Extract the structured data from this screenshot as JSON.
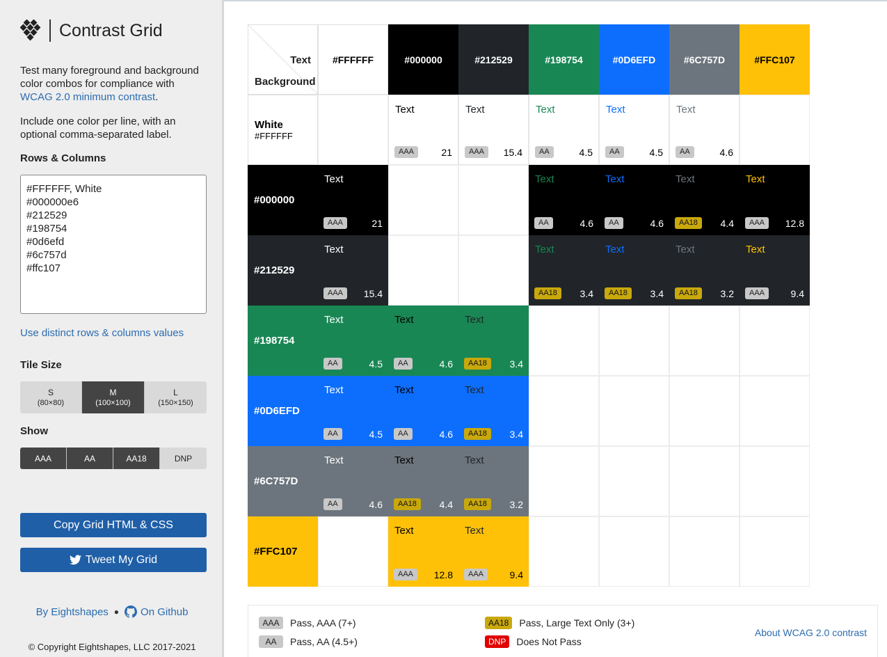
{
  "sidebar": {
    "title": "Contrast Grid",
    "intro_text": "Test many foreground and background color combos for compliance with",
    "intro_link": "WCAG 2.0 minimum contrast",
    "intro_end": ".",
    "intro2": "Include one color per line, with an optional comma-separated label.",
    "rows_label": "Rows & Columns",
    "rows_value": "#FFFFFF, White\n#000000e6\n#212529\n#198754\n#0d6efd\n#6c757d\n#ffc107",
    "distinct_link": "Use distinct rows & columns values",
    "tile_size_label": "Tile Size",
    "tile_sizes": [
      {
        "label": "S",
        "sub": "(80×80)",
        "selected": false
      },
      {
        "label": "M",
        "sub": "(100×100)",
        "selected": true
      },
      {
        "label": "L",
        "sub": "(150×150)",
        "selected": false
      }
    ],
    "show_label": "Show",
    "show_options": [
      {
        "label": "AAA",
        "selected": true
      },
      {
        "label": "AA",
        "selected": true
      },
      {
        "label": "AA18",
        "selected": true
      },
      {
        "label": "DNP",
        "selected": false
      }
    ],
    "copy_button": "Copy Grid HTML & CSS",
    "tweet_button": "Tweet My Grid",
    "by_link": "By Eightshapes",
    "github_link": "On Github",
    "copyright": "© Copyright Eightshapes, LLC 2017-2021"
  },
  "grid": {
    "corner_text": "Text",
    "corner_bg": "Background",
    "tile_word": "Text",
    "columns": [
      {
        "label": "#FFFFFF",
        "color": "#FFFFFF",
        "text": "#000000"
      },
      {
        "label": "#000000",
        "color": "#000000",
        "text": "#FFFFFF"
      },
      {
        "label": "#212529",
        "color": "#212529",
        "text": "#FFFFFF"
      },
      {
        "label": "#198754",
        "color": "#198754",
        "text": "#FFFFFF"
      },
      {
        "label": "#0D6EFD",
        "color": "#0D6EFD",
        "text": "#FFFFFF"
      },
      {
        "label": "#6C757D",
        "color": "#6C757D",
        "text": "#FFFFFF"
      },
      {
        "label": "#FFC107",
        "color": "#FFC107",
        "text": "#000000"
      }
    ],
    "rows": [
      {
        "label": "White",
        "sub": "#FFFFFF",
        "color": "#FFFFFF",
        "text": "#000000",
        "cells": [
          null,
          {
            "badge": "AAA",
            "ratio": "21"
          },
          {
            "badge": "AAA",
            "ratio": "15.4"
          },
          {
            "badge": "AA",
            "ratio": "4.5"
          },
          {
            "badge": "AA",
            "ratio": "4.5"
          },
          {
            "badge": "AA",
            "ratio": "4.6"
          },
          null
        ]
      },
      {
        "label": "#000000",
        "sub": "",
        "color": "#000000",
        "text": "#FFFFFF",
        "cells": [
          {
            "badge": "AAA",
            "ratio": "21"
          },
          null,
          null,
          {
            "badge": "AA",
            "ratio": "4.6"
          },
          {
            "badge": "AA",
            "ratio": "4.6"
          },
          {
            "badge": "AA18",
            "ratio": "4.4"
          },
          {
            "badge": "AAA",
            "ratio": "12.8"
          }
        ]
      },
      {
        "label": "#212529",
        "sub": "",
        "color": "#212529",
        "text": "#FFFFFF",
        "cells": [
          {
            "badge": "AAA",
            "ratio": "15.4"
          },
          null,
          null,
          {
            "badge": "AA18",
            "ratio": "3.4"
          },
          {
            "badge": "AA18",
            "ratio": "3.4"
          },
          {
            "badge": "AA18",
            "ratio": "3.2"
          },
          {
            "badge": "AAA",
            "ratio": "9.4"
          }
        ]
      },
      {
        "label": "#198754",
        "sub": "",
        "color": "#198754",
        "text": "#FFFFFF",
        "cells": [
          {
            "badge": "AA",
            "ratio": "4.5"
          },
          {
            "badge": "AA",
            "ratio": "4.6"
          },
          {
            "badge": "AA18",
            "ratio": "3.4"
          },
          null,
          null,
          null,
          null
        ]
      },
      {
        "label": "#0D6EFD",
        "sub": "",
        "color": "#0D6EFD",
        "text": "#FFFFFF",
        "cells": [
          {
            "badge": "AA",
            "ratio": "4.5"
          },
          {
            "badge": "AA",
            "ratio": "4.6"
          },
          {
            "badge": "AA18",
            "ratio": "3.4"
          },
          null,
          null,
          null,
          null
        ]
      },
      {
        "label": "#6C757D",
        "sub": "",
        "color": "#6C757D",
        "text": "#FFFFFF",
        "cells": [
          {
            "badge": "AA",
            "ratio": "4.6"
          },
          {
            "badge": "AA18",
            "ratio": "4.4"
          },
          {
            "badge": "AA18",
            "ratio": "3.2"
          },
          null,
          null,
          null,
          null
        ]
      },
      {
        "label": "#FFC107",
        "sub": "",
        "color": "#FFC107",
        "text": "#000000",
        "cells": [
          null,
          {
            "badge": "AAA",
            "ratio": "12.8"
          },
          {
            "badge": "AAA",
            "ratio": "9.4"
          },
          null,
          null,
          null,
          null
        ]
      }
    ]
  },
  "legend": {
    "items": [
      {
        "badge": "AAA",
        "text": "Pass, AAA (7+)",
        "bg": "#c8c8c8",
        "fg": "#222222"
      },
      {
        "badge": "AA",
        "text": "Pass, AA (4.5+)",
        "bg": "#c8c8c8",
        "fg": "#222222"
      },
      {
        "badge": "AA18",
        "text": "Pass, Large Text Only (3+)",
        "bg": "#c9a80c",
        "fg": "#111111"
      },
      {
        "badge": "DNP",
        "text": "Does Not Pass",
        "bg": "#e00000",
        "fg": "#ffffff"
      }
    ],
    "about_link": "About WCAG 2.0 contrast"
  }
}
